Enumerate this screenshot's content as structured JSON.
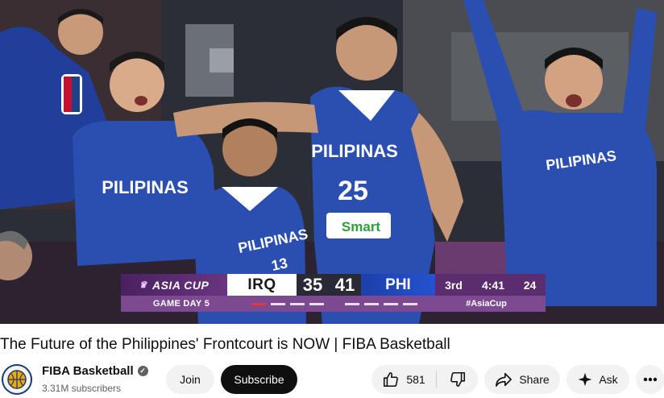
{
  "video": {
    "scorebug": {
      "league": "ASIA CUP",
      "team_a": "IRQ",
      "score_a": "35",
      "score_b": "41",
      "team_b": "PHI",
      "period": "3rd",
      "clock": "4:41",
      "shot_clock": "24",
      "game_day": "GAME DAY 5",
      "hashtag": "#AsiaCup"
    },
    "jersey_text": {
      "bench_left": "PILIPINAS",
      "player_center": "PILIPINAS",
      "player_center_number": "25",
      "player_center_sponsor": "Smart",
      "player_left": "PILIPINAS",
      "player_left_number": "13",
      "bench_right": "PILIPINAS"
    }
  },
  "title": "The Future of the Philippines' Frontcourt is NOW | FIBA Basketball",
  "channel": {
    "name": "FIBA Basketball",
    "subscribers": "3.31M subscribers",
    "verified_icon": "verified-check-icon"
  },
  "actions": {
    "join": "Join",
    "subscribe": "Subscribe",
    "likes": "581",
    "share": "Share",
    "ask": "Ask"
  },
  "colors": {
    "scorebug_purple": "#5b2d6e",
    "team_b_blue": "#2552d1",
    "jersey_blue": "#2a4fb0",
    "subscribe_bg": "#0f0f0f"
  }
}
